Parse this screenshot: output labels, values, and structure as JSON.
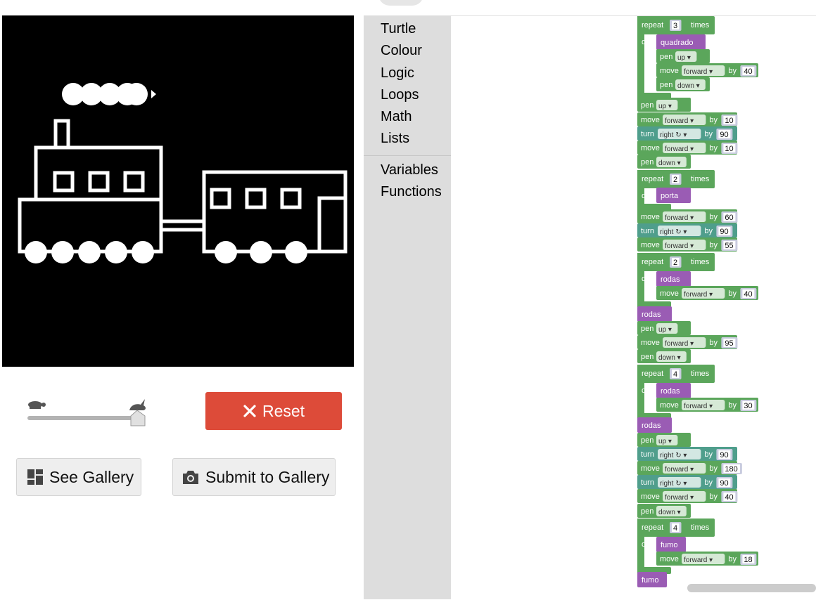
{
  "toolbox": {
    "categories": [
      "Turtle",
      "Colour",
      "Logic",
      "Loops",
      "Math",
      "Lists",
      "Variables",
      "Functions"
    ]
  },
  "controls": {
    "reset_label": "Reset",
    "see_gallery_label": "See Gallery",
    "submit_gallery_label": "Submit to Gallery",
    "speed_value": 1.0
  },
  "icons": {
    "slow": "turtle-icon",
    "fast": "rabbit-icon",
    "reset": "close-icon",
    "gallery": "dashboard-icon",
    "submit": "camera-icon"
  },
  "colors": {
    "turtle_block": "#5ba65b",
    "turtle_block_alt": "#4f9e8c",
    "procedure_block": "#9a5cb4",
    "number_field": "#c9ccdf",
    "reset_button": "#dd4b39",
    "canvas_bg": "#000000",
    "drawing": "#ffffff"
  },
  "program": [
    {
      "kind": "pen",
      "value": "down",
      "depth": 0
    },
    {
      "kind": "repeat",
      "times": "3",
      "depth": 0
    },
    {
      "kind": "call",
      "name": "quadrado",
      "depth": 1
    },
    {
      "kind": "pen",
      "value": "up",
      "depth": 1
    },
    {
      "kind": "move",
      "dir": "forward",
      "by": "40",
      "depth": 1
    },
    {
      "kind": "pen",
      "value": "down",
      "depth": 1
    },
    {
      "kind": "pen",
      "value": "up",
      "depth": 0
    },
    {
      "kind": "move",
      "dir": "forward",
      "by": "10",
      "depth": 0
    },
    {
      "kind": "turn",
      "dir": "right ↻",
      "by": "90",
      "depth": 0
    },
    {
      "kind": "move",
      "dir": "forward",
      "by": "10",
      "depth": 0
    },
    {
      "kind": "pen",
      "value": "down",
      "depth": 0
    },
    {
      "kind": "repeat",
      "times": "2",
      "depth": 0
    },
    {
      "kind": "call",
      "name": "porta",
      "depth": 1
    },
    {
      "kind": "move",
      "dir": "forward",
      "by": "60",
      "depth": 0
    },
    {
      "kind": "turn",
      "dir": "right ↻",
      "by": "90",
      "depth": 0
    },
    {
      "kind": "move",
      "dir": "forward",
      "by": "55",
      "depth": 0
    },
    {
      "kind": "repeat",
      "times": "2",
      "depth": 0
    },
    {
      "kind": "call",
      "name": "rodas",
      "depth": 1
    },
    {
      "kind": "move",
      "dir": "forward",
      "by": "40",
      "depth": 1
    },
    {
      "kind": "call",
      "name": "rodas",
      "depth": 0
    },
    {
      "kind": "pen",
      "value": "up",
      "depth": 0
    },
    {
      "kind": "move",
      "dir": "forward",
      "by": "95",
      "depth": 0
    },
    {
      "kind": "pen",
      "value": "down",
      "depth": 0
    },
    {
      "kind": "repeat",
      "times": "4",
      "depth": 0
    },
    {
      "kind": "call",
      "name": "rodas",
      "depth": 1
    },
    {
      "kind": "move",
      "dir": "forward",
      "by": "30",
      "depth": 1
    },
    {
      "kind": "call",
      "name": "rodas",
      "depth": 0
    },
    {
      "kind": "pen",
      "value": "up",
      "depth": 0
    },
    {
      "kind": "turn",
      "dir": "right ↻",
      "by": "90",
      "depth": 0
    },
    {
      "kind": "move",
      "dir": "forward",
      "by": "180",
      "depth": 0
    },
    {
      "kind": "turn",
      "dir": "right ↻",
      "by": "90",
      "depth": 0
    },
    {
      "kind": "move",
      "dir": "forward",
      "by": "40",
      "depth": 0
    },
    {
      "kind": "pen",
      "value": "down",
      "depth": 0
    },
    {
      "kind": "repeat",
      "times": "4",
      "depth": 0
    },
    {
      "kind": "call",
      "name": "fumo",
      "depth": 1
    },
    {
      "kind": "move",
      "dir": "forward",
      "by": "18",
      "depth": 1
    },
    {
      "kind": "call",
      "name": "fumo",
      "depth": 0
    }
  ],
  "labels": {
    "pen": "pen",
    "move": "move",
    "turn": "turn",
    "by": "by",
    "repeat": "repeat",
    "times": "times",
    "do": "do"
  }
}
